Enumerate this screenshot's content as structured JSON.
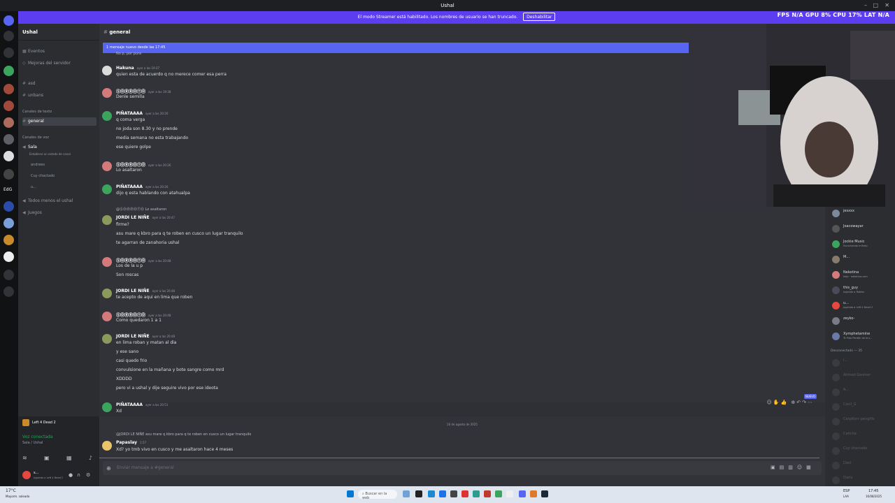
{
  "window": {
    "title": "Ushal"
  },
  "banner": {
    "text": "El modo Streamer está habilitado. Los nombres de usuario se han truncado.",
    "button": "Deshabilitar"
  },
  "stats": {
    "fps_label": "FPS",
    "fps": "N/A",
    "gpu_label": "GPU",
    "gpu": "8%",
    "cpu_label": "CPU",
    "cpu": "17%",
    "lat_label": "LAT",
    "lat": "N/A"
  },
  "rail": {
    "edg_label": "EdG"
  },
  "sidebar": {
    "server": "Ushal",
    "items": [
      {
        "label": "Eventos"
      },
      {
        "label": "Mejoras del servidor"
      },
      {
        "label": "asd"
      },
      {
        "label": "unbans"
      },
      {
        "label": "Canales de texto"
      },
      {
        "label": "general"
      },
      {
        "label": "Canales de voz"
      },
      {
        "label": "Sala"
      },
      {
        "label": "Establece un estado de canal"
      },
      {
        "label": "andrees"
      },
      {
        "label": "Cuy chactado"
      },
      {
        "label": "u..."
      },
      {
        "label": "Todos menos el ushal"
      },
      {
        "label": "Juegos"
      }
    ],
    "game": "Left 4 Dead 2",
    "voice_status": "Voz conectada",
    "voice_channel": "Sala / Ushal",
    "user_name": "s...",
    "user_status": "Jugando a Left 4 Dead 2"
  },
  "chat": {
    "channel": "general",
    "new_banner": "1 mensaje nuevo desde las 17:45",
    "top_cut": "No p, por pura",
    "messages": [
      {
        "author": "Hakuna",
        "time": "ayer a las 19:37",
        "lines": [
          "quien esta de acuerdo q no merece comer esa perra"
        ]
      },
      {
        "author": "ⓈⓄⓇⓇⓄⓉⓄ",
        "time": "ayer a las 19:38",
        "lines": [
          "Denle semilla"
        ]
      },
      {
        "author": "PIÑATAAAA",
        "time": "ayer a las 20:20",
        "lines": [
          "q coma verga",
          "no joda son 8.30 y no prende",
          "media semana no esta trabajando",
          "ese quiere golpe"
        ]
      },
      {
        "author": "ⓈⓄⓇⓇⓄⓉⓄ",
        "time": "ayer a las 20:26",
        "lines": [
          "Lo asaltaron"
        ]
      },
      {
        "author": "PIÑATAAAA",
        "time": "ayer a las 20:26",
        "lines": [
          "dijo q esta hablando con atahualpa"
        ]
      },
      {
        "author": "JORDI LE NIÑE",
        "time": "ayer a las 20:47",
        "reply": "@ⓈⓄⓇⓇⓄⓉⓄ Lo asaltaron",
        "lines": [
          "firme?",
          "asu mare q kbro para q te roben en cusco un lugar tranquilo",
          "te agarran de zanahoria ushal"
        ]
      },
      {
        "author": "ⓈⓄⓇⓇⓄⓉⓄ",
        "time": "ayer a las 20:48",
        "lines": [
          "Los de la u p",
          "Son roscas"
        ]
      },
      {
        "author": "JORDI LE NIÑE",
        "time": "ayer a las 20:48",
        "lines": [
          "te acepto de aqui en lima que roben"
        ]
      },
      {
        "author": "ⓈⓄⓇⓇⓄⓉⓄ",
        "time": "ayer a las 20:48",
        "lines": [
          "Como quedaron 1 a 1"
        ]
      },
      {
        "author": "JORDI LE NIÑE",
        "time": "ayer a las 20:48",
        "lines": [
          "en lima roban y matan al dia",
          "y ese sano",
          "casi quedo frio",
          "convulsione en la mañana y bote sangre como mrd",
          "XDDDD",
          "pero vi a ushal y dije seguire vivo por ese ideota"
        ]
      },
      {
        "author": "PIÑATAAAA",
        "time": "ayer a las 20:51",
        "lines": [
          "Xd"
        ]
      },
      {
        "author": "Papaslay",
        "time": "1:57",
        "reply": "@JORDI LE NIÑE asu mare q kbro para q te roben en cusco un lugar tranquilo",
        "lines": [
          "Xd? yo tmb vivo en cusco y me asaltaron hace 4 meses"
        ]
      }
    ],
    "date_separator": "16 de agosto de 2025",
    "new_badge": "NUEVO",
    "composer_placeholder": "Enviar mensaje a #general"
  },
  "members": {
    "list": [
      {
        "name": "jesxxx",
        "status": ""
      },
      {
        "name": "Joacowayar",
        "status": ""
      },
      {
        "name": "Jockie Music",
        "status": "Escuchando m!help"
      },
      {
        "name": "M...",
        "status": ""
      },
      {
        "name": "Nekotina",
        "status": "help · nekotina.com"
      },
      {
        "name": "this_guy",
        "status": "Jugando a Roblox"
      },
      {
        "name": "u...",
        "status": "Jugando a Left 4 Dead 2"
      },
      {
        "name": "zeyko-",
        "status": ""
      },
      {
        "name": "Xymphetamine",
        "status": "Te Pido Perdón de la s..."
      }
    ],
    "offline_header": "Desconectado — 35",
    "offline": [
      "I...",
      "Ahmed Goomer",
      "A...",
      "Cocil_G",
      "Carpiforn pengifis",
      "Cahcha",
      "Cuy chactado",
      "Dani",
      "Dario"
    ]
  },
  "taskbar": {
    "weather": "17°C",
    "weather_sub": "Mayorm. soleado",
    "search": "Buscar en la web",
    "lang": "ESP",
    "lang2": "LAA",
    "time": "17:45",
    "date": "16/08/2025"
  },
  "colors": {
    "accent": "#5865f2",
    "banner": "#5d3df0",
    "bg": "#313338"
  }
}
